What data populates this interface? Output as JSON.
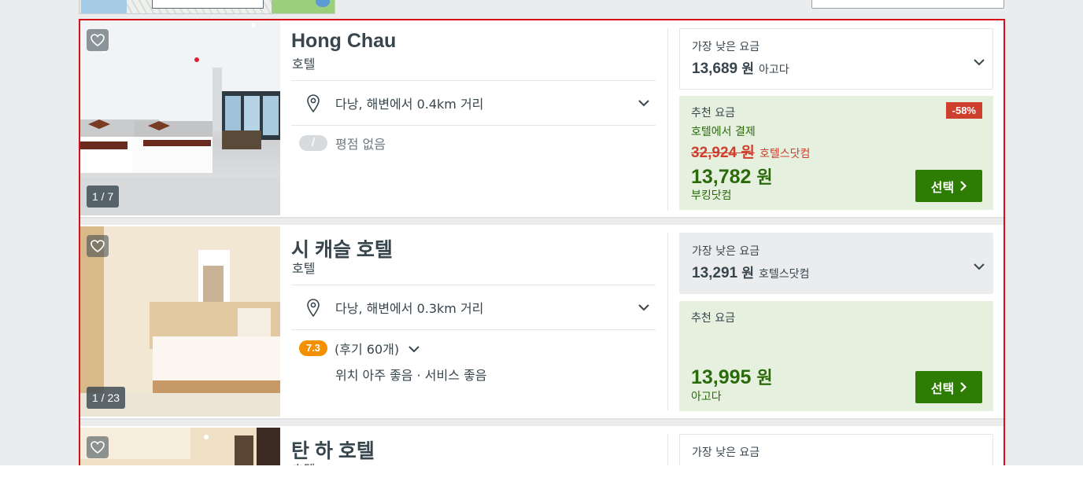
{
  "colors": {
    "highlight_border": "#d4101b",
    "deal_green": "#2b6a0b",
    "select_button": "#2d7d05",
    "discount_red": "#cf3f2e",
    "rating_orange": "#f48f00",
    "recommended_bg": "#e6f0df"
  },
  "hotels": [
    {
      "name": "Hong Chau",
      "type": "호텔",
      "photo_counter": "1 / 7",
      "location": "다낭, 해변에서 0.4km 거리",
      "rating_badge": "/",
      "rating_text": "평점 없음",
      "lowest_label": "가장 낮은 요금",
      "lowest_price": "13,689",
      "lowest_unit": "원",
      "lowest_provider": "아고다",
      "rec_label": "추천 요금",
      "discount": "-58%",
      "pay_note": "호텔에서 결제",
      "original_price": "32,924 원",
      "original_provider": "호텔스닷컴",
      "rec_price": "13,782",
      "rec_unit": "원",
      "rec_provider": "부킹닷컴",
      "select_label": "선택"
    },
    {
      "name": "시 캐슬 호텔",
      "type": "호텔",
      "photo_counter": "1 / 23",
      "location": "다낭, 해변에서 0.3km 거리",
      "rating_badge": "7.3",
      "review_count": "(후기 60개)",
      "tags": "위치 아주 좋음 · 서비스 좋음",
      "lowest_label": "가장 낮은 요금",
      "lowest_price": "13,291",
      "lowest_unit": "원",
      "lowest_provider": "호텔스닷컴",
      "rec_label": "추천 요금",
      "rec_price": "13,995",
      "rec_unit": "원",
      "rec_provider": "아고다",
      "select_label": "선택"
    },
    {
      "name": "탄 하 호텔",
      "type": "호텔",
      "lowest_label": "가장 낮은 요금"
    }
  ]
}
